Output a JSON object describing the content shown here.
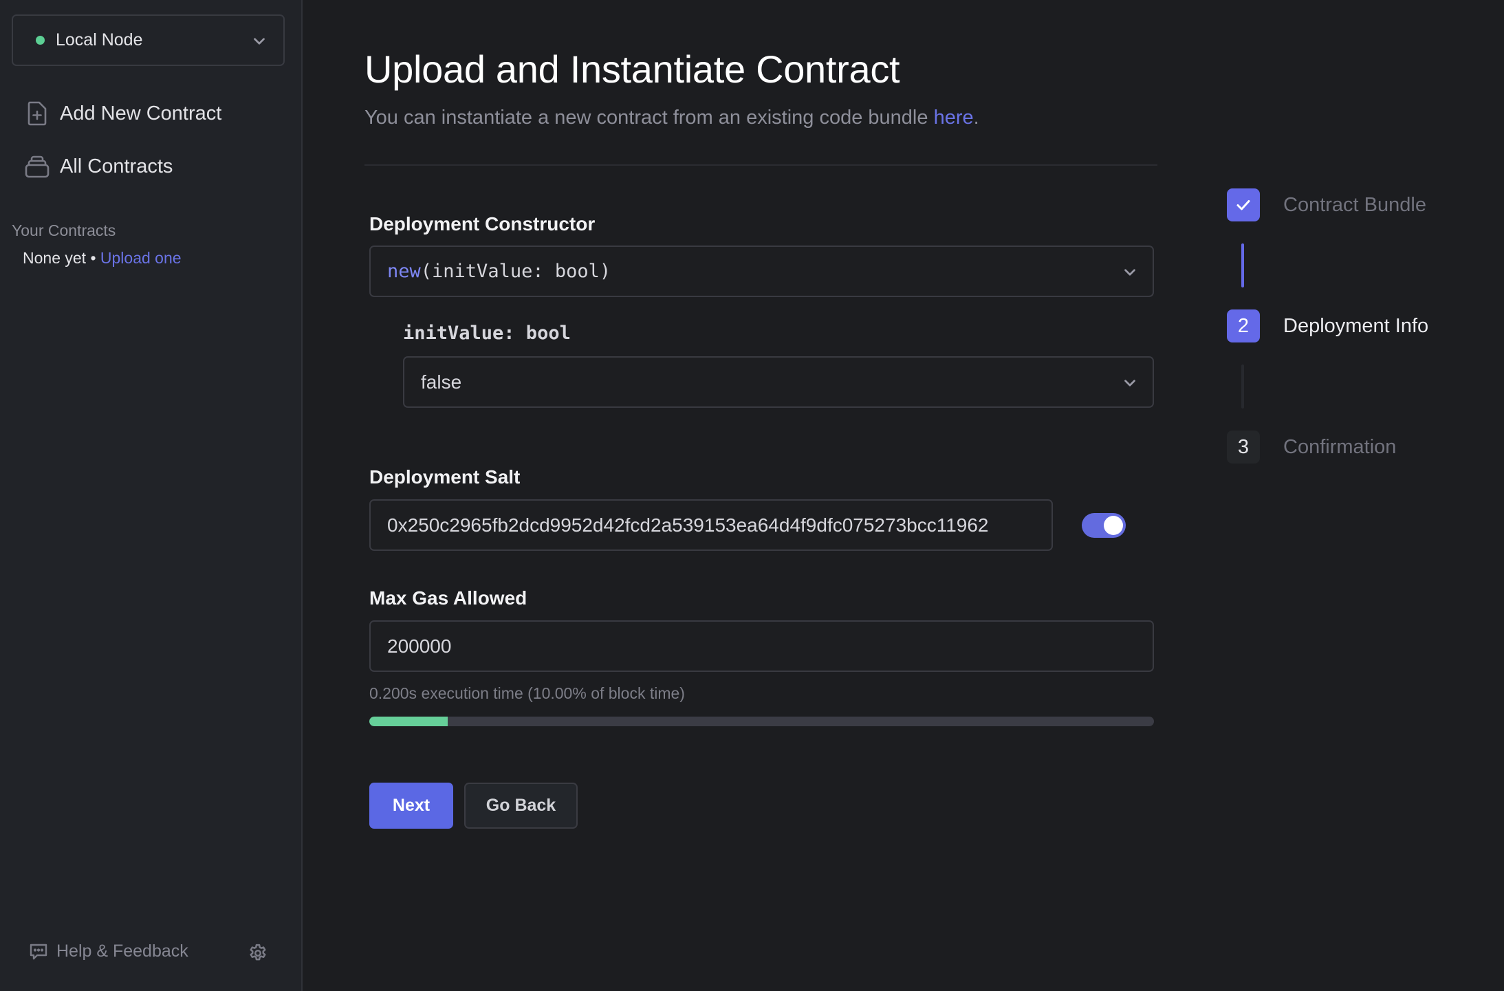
{
  "sidebar": {
    "node_selector": {
      "label": "Local Node",
      "status_color": "#5ccf94"
    },
    "nav": [
      {
        "label": "Add New Contract",
        "icon": "file-plus-icon"
      },
      {
        "label": "All Contracts",
        "icon": "stack-icon"
      }
    ],
    "your_contracts": {
      "heading": "Your Contracts",
      "empty_text": "None yet",
      "separator": "•",
      "upload_link": "Upload one"
    },
    "footer": {
      "help_label": "Help & Feedback",
      "help_icon": "chat-bubble-icon",
      "settings_icon": "gear-icon"
    }
  },
  "main": {
    "title": "Upload and Instantiate Contract",
    "subtitle": "You can instantiate a new contract from an existing code bundle ",
    "subtitle_link": "here",
    "subtitle_end": ".",
    "constructor": {
      "label": "Deployment Constructor",
      "selected_keyword": "new",
      "selected_args": "(initValue: bool)"
    },
    "init_value": {
      "label": "initValue: bool",
      "selected": "false"
    },
    "salt": {
      "label": "Deployment Salt",
      "value": "0x250c2965fb2dcd9952d42fcd2a539153ea64d4f9dfc075273bcc11962",
      "toggle_on": true
    },
    "gas": {
      "label": "Max Gas Allowed",
      "value": "200000",
      "hint": "0.200s execution time (10.00% of block time)",
      "progress_percent": 10
    },
    "buttons": {
      "next": "Next",
      "back": "Go Back"
    }
  },
  "stepper": {
    "steps": [
      {
        "marker": "✓",
        "label": "Contract Bundle",
        "state": "complete"
      },
      {
        "marker": "2",
        "label": "Deployment Info",
        "state": "current"
      },
      {
        "marker": "3",
        "label": "Confirmation",
        "state": "pending"
      }
    ]
  },
  "colors": {
    "accent": "#5b68e4",
    "success": "#66cf99",
    "link": "#6a73e6"
  }
}
